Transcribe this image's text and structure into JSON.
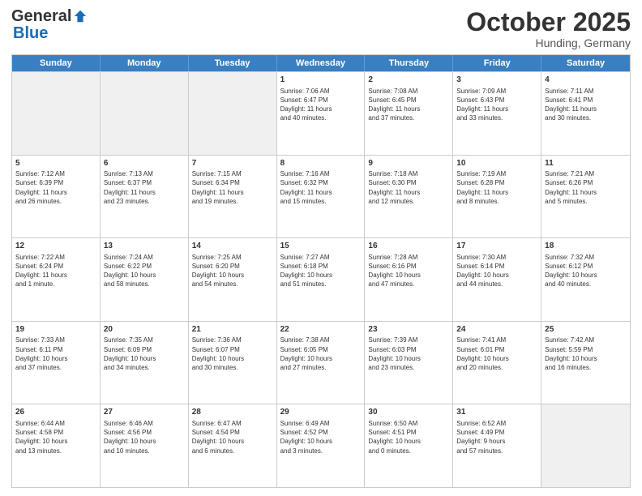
{
  "header": {
    "logo_general": "General",
    "logo_blue": "Blue",
    "month_title": "October 2025",
    "subtitle": "Hunding, Germany"
  },
  "days": [
    "Sunday",
    "Monday",
    "Tuesday",
    "Wednesday",
    "Thursday",
    "Friday",
    "Saturday"
  ],
  "weeks": [
    [
      {
        "day": "",
        "text": "",
        "shaded": true
      },
      {
        "day": "",
        "text": "",
        "shaded": true
      },
      {
        "day": "",
        "text": "",
        "shaded": true
      },
      {
        "day": "1",
        "text": "Sunrise: 7:06 AM\nSunset: 6:47 PM\nDaylight: 11 hours\nand 40 minutes.",
        "shaded": false
      },
      {
        "day": "2",
        "text": "Sunrise: 7:08 AM\nSunset: 6:45 PM\nDaylight: 11 hours\nand 37 minutes.",
        "shaded": false
      },
      {
        "day": "3",
        "text": "Sunrise: 7:09 AM\nSunset: 6:43 PM\nDaylight: 11 hours\nand 33 minutes.",
        "shaded": false
      },
      {
        "day": "4",
        "text": "Sunrise: 7:11 AM\nSunset: 6:41 PM\nDaylight: 11 hours\nand 30 minutes.",
        "shaded": false
      }
    ],
    [
      {
        "day": "5",
        "text": "Sunrise: 7:12 AM\nSunset: 6:39 PM\nDaylight: 11 hours\nand 26 minutes.",
        "shaded": false
      },
      {
        "day": "6",
        "text": "Sunrise: 7:13 AM\nSunset: 6:37 PM\nDaylight: 11 hours\nand 23 minutes.",
        "shaded": false
      },
      {
        "day": "7",
        "text": "Sunrise: 7:15 AM\nSunset: 6:34 PM\nDaylight: 11 hours\nand 19 minutes.",
        "shaded": false
      },
      {
        "day": "8",
        "text": "Sunrise: 7:16 AM\nSunset: 6:32 PM\nDaylight: 11 hours\nand 15 minutes.",
        "shaded": false
      },
      {
        "day": "9",
        "text": "Sunrise: 7:18 AM\nSunset: 6:30 PM\nDaylight: 11 hours\nand 12 minutes.",
        "shaded": false
      },
      {
        "day": "10",
        "text": "Sunrise: 7:19 AM\nSunset: 6:28 PM\nDaylight: 11 hours\nand 8 minutes.",
        "shaded": false
      },
      {
        "day": "11",
        "text": "Sunrise: 7:21 AM\nSunset: 6:26 PM\nDaylight: 11 hours\nand 5 minutes.",
        "shaded": false
      }
    ],
    [
      {
        "day": "12",
        "text": "Sunrise: 7:22 AM\nSunset: 6:24 PM\nDaylight: 11 hours\nand 1 minute.",
        "shaded": false
      },
      {
        "day": "13",
        "text": "Sunrise: 7:24 AM\nSunset: 6:22 PM\nDaylight: 10 hours\nand 58 minutes.",
        "shaded": false
      },
      {
        "day": "14",
        "text": "Sunrise: 7:25 AM\nSunset: 6:20 PM\nDaylight: 10 hours\nand 54 minutes.",
        "shaded": false
      },
      {
        "day": "15",
        "text": "Sunrise: 7:27 AM\nSunset: 6:18 PM\nDaylight: 10 hours\nand 51 minutes.",
        "shaded": false
      },
      {
        "day": "16",
        "text": "Sunrise: 7:28 AM\nSunset: 6:16 PM\nDaylight: 10 hours\nand 47 minutes.",
        "shaded": false
      },
      {
        "day": "17",
        "text": "Sunrise: 7:30 AM\nSunset: 6:14 PM\nDaylight: 10 hours\nand 44 minutes.",
        "shaded": false
      },
      {
        "day": "18",
        "text": "Sunrise: 7:32 AM\nSunset: 6:12 PM\nDaylight: 10 hours\nand 40 minutes.",
        "shaded": false
      }
    ],
    [
      {
        "day": "19",
        "text": "Sunrise: 7:33 AM\nSunset: 6:11 PM\nDaylight: 10 hours\nand 37 minutes.",
        "shaded": false
      },
      {
        "day": "20",
        "text": "Sunrise: 7:35 AM\nSunset: 6:09 PM\nDaylight: 10 hours\nand 34 minutes.",
        "shaded": false
      },
      {
        "day": "21",
        "text": "Sunrise: 7:36 AM\nSunset: 6:07 PM\nDaylight: 10 hours\nand 30 minutes.",
        "shaded": false
      },
      {
        "day": "22",
        "text": "Sunrise: 7:38 AM\nSunset: 6:05 PM\nDaylight: 10 hours\nand 27 minutes.",
        "shaded": false
      },
      {
        "day": "23",
        "text": "Sunrise: 7:39 AM\nSunset: 6:03 PM\nDaylight: 10 hours\nand 23 minutes.",
        "shaded": false
      },
      {
        "day": "24",
        "text": "Sunrise: 7:41 AM\nSunset: 6:01 PM\nDaylight: 10 hours\nand 20 minutes.",
        "shaded": false
      },
      {
        "day": "25",
        "text": "Sunrise: 7:42 AM\nSunset: 5:59 PM\nDaylight: 10 hours\nand 16 minutes.",
        "shaded": false
      }
    ],
    [
      {
        "day": "26",
        "text": "Sunrise: 6:44 AM\nSunset: 4:58 PM\nDaylight: 10 hours\nand 13 minutes.",
        "shaded": false
      },
      {
        "day": "27",
        "text": "Sunrise: 6:46 AM\nSunset: 4:56 PM\nDaylight: 10 hours\nand 10 minutes.",
        "shaded": false
      },
      {
        "day": "28",
        "text": "Sunrise: 6:47 AM\nSunset: 4:54 PM\nDaylight: 10 hours\nand 6 minutes.",
        "shaded": false
      },
      {
        "day": "29",
        "text": "Sunrise: 6:49 AM\nSunset: 4:52 PM\nDaylight: 10 hours\nand 3 minutes.",
        "shaded": false
      },
      {
        "day": "30",
        "text": "Sunrise: 6:50 AM\nSunset: 4:51 PM\nDaylight: 10 hours\nand 0 minutes.",
        "shaded": false
      },
      {
        "day": "31",
        "text": "Sunrise: 6:52 AM\nSunset: 4:49 PM\nDaylight: 9 hours\nand 57 minutes.",
        "shaded": false
      },
      {
        "day": "",
        "text": "",
        "shaded": true
      }
    ]
  ]
}
